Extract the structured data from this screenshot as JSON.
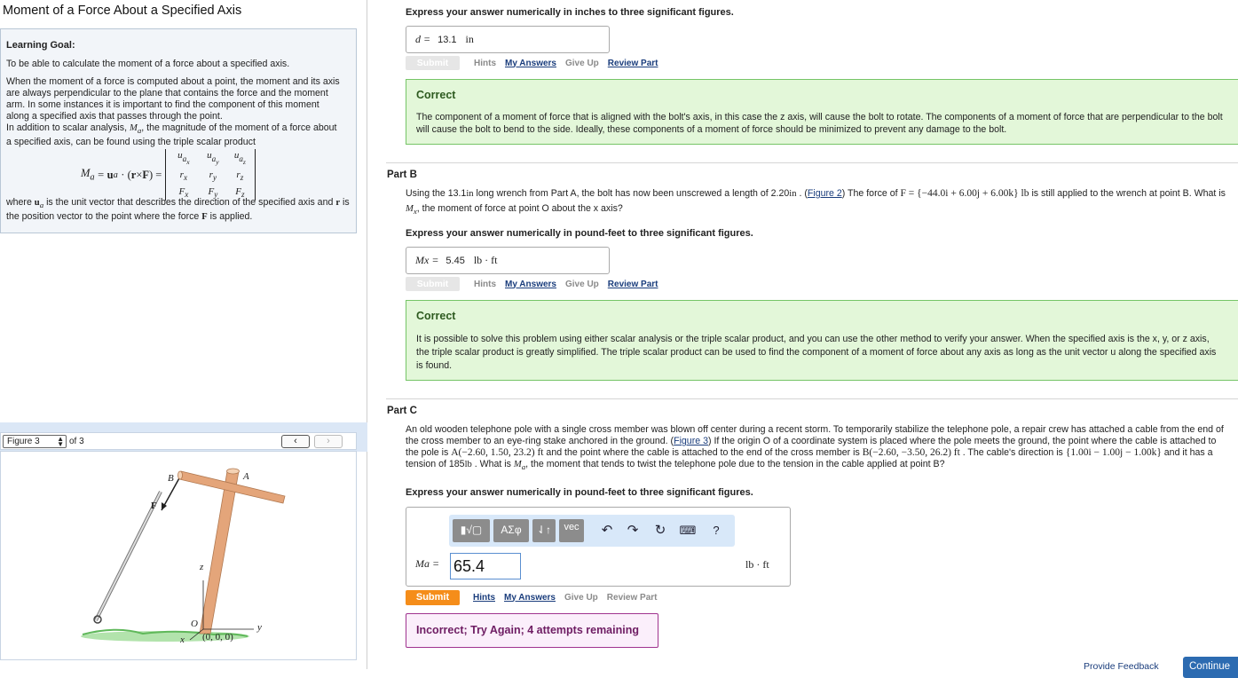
{
  "left": {
    "title": "Moment of a Force About a Specified Axis",
    "learning_goal_heading": "Learning Goal:",
    "goal_text": "To be able to calculate the moment of a force about a specified axis.",
    "para1": "When the moment of a force is computed about a point, the moment and its axis are always perpendicular to the plane that contains the force and the moment arm. In some instances it is important to find the component of this moment along a specified axis that passes through the point.",
    "para2_a": "In addition to scalar analysis, ",
    "para2_b": ", the magnitude of the moment of a force about a specified axis, can be found using the triple scalar product",
    "para3_a": "where ",
    "para3_b": " is the unit vector that describes the direction of the specified axis and ",
    "para3_c": " is the position vector to the point where the force ",
    "para3_d": " is applied.",
    "figure": {
      "select_value": "Figure 3",
      "of_text": "of 3",
      "labels": {
        "b": "B",
        "a": "A",
        "f": "F",
        "z": "z",
        "o": "O",
        "y": "y",
        "x": "x",
        "origin": "(0, 0, 0)"
      }
    }
  },
  "partA": {
    "instruction": "Express your answer numerically in inches to three significant figures.",
    "answer_label": "d =",
    "answer_value": "13.1",
    "answer_unit": "in",
    "submit": "Submit",
    "hints": "Hints",
    "my_answers": "My Answers",
    "give_up": "Give Up",
    "review_part": "Review Part",
    "result_heading": "Correct",
    "result_text": "The component of a moment of force that is aligned with the bolt's axis, in this case the z axis, will cause the bolt to rotate. The components of a moment of force that are perpendicular to the bolt will cause the bolt to bend to the side. Ideally, these components of a moment of force should be minimized to prevent any damage to the bolt."
  },
  "partB": {
    "title": "Part B",
    "q_a": "Using the 13.1",
    "q_unit_in": "in",
    "q_b": " long wrench from Part A, the bolt has now been unscrewed a length of 2.20",
    "q_c": " . (",
    "figure_link": "Figure 2",
    "q_d": ") The force of ",
    "q_force": "F = {−44.0i + 6.00j + 6.00k} lb",
    "q_e": " is still applied to the wrench at point B. What is ",
    "q_f": ", the moment of force at point O about the x axis?",
    "instruction": "Express your answer numerically in pound-feet to three significant figures.",
    "answer_label": "Mx =",
    "answer_value": "5.45",
    "answer_unit": "lb · ft",
    "submit": "Submit",
    "hints": "Hints",
    "my_answers": "My Answers",
    "give_up": "Give Up",
    "review_part": "Review Part",
    "result_heading": "Correct",
    "result_text": "It is possible to solve this problem using either scalar analysis or the triple scalar product, and you can use the other method to verify your answer. When the specified axis is the x, y, or z axis, the triple scalar product is greatly simplified. The triple scalar product can be used to find the component of a moment of force about any axis as long as the unit vector u along the specified axis is found."
  },
  "partC": {
    "title": "Part C",
    "q_a": "An old wooden telephone pole with a single cross member was blown off center during a recent storm. To temporarily stabilize the telephone pole, a repair crew has attached a cable from the end of the cross member to an eye-ring stake anchored in the ground. (",
    "figure_link": "Figure 3",
    "q_b": ") If the origin O of a coordinate system is placed where the pole meets the ground, the point where the cable is attached to the pole is ",
    "q_pointA": "A(−2.60, 1.50, 23.2) ft",
    "q_c": " and the point where the cable is attached to the end of the cross member is ",
    "q_pointB": "B(−2.60, −3.50, 26.2) ft",
    "q_d": " . The cable's direction is ",
    "q_dir": "{1.00i − 1.00j − 1.00k}",
    "q_e": " and it has a tension of 185",
    "q_unit": "lb",
    "q_f": " . What is ",
    "q_g": ", the moment that tends to twist the telephone pole due to the tension in the cable applied at point B?",
    "instruction": "Express your answer numerically in pound-feet to three significant figures.",
    "toolbar": {
      "templates": "▮√▢",
      "greek": "ΑΣφ",
      "arrows": "⇃↑",
      "vec": "vec",
      "help": "?"
    },
    "answer_label": "Ma =",
    "answer_value": "65.4",
    "answer_unit": "lb · ft",
    "submit": "Submit",
    "hints": "Hints",
    "my_answers": "My Answers",
    "give_up": "Give Up",
    "review_part": "Review Part",
    "result_text": "Incorrect; Try Again; 4 attempts remaining"
  },
  "footer": {
    "feedback": "Provide Feedback",
    "continue": "Continue"
  },
  "colors": {
    "correct_bg": "#e3f7d9",
    "correct_border": "#76c567",
    "incorrect_border": "#a0348f",
    "submit_orange": "#f58d1a",
    "link_blue": "#1a3d7c"
  },
  "icons": [
    "undo-icon",
    "redo-icon",
    "reset-icon",
    "keyboard-icon",
    "help-icon"
  ]
}
